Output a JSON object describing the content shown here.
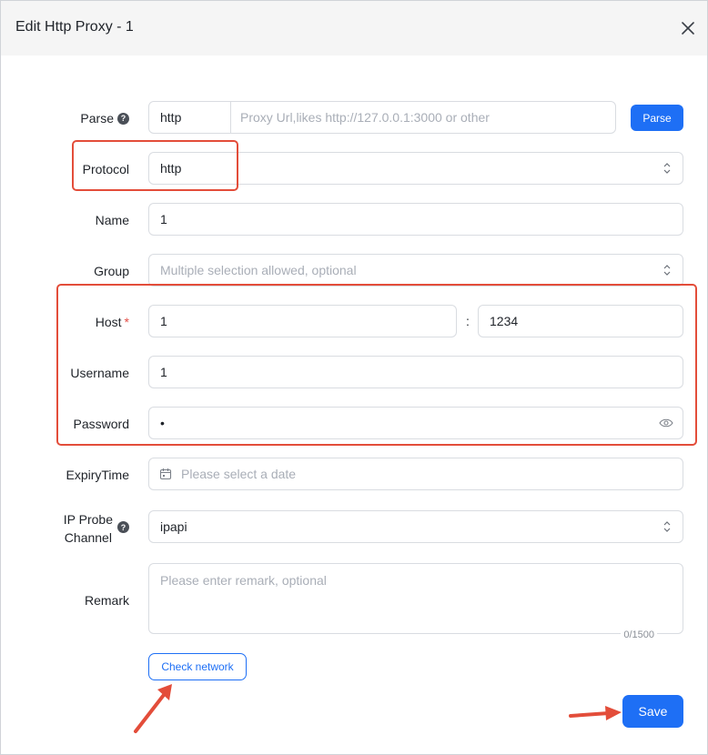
{
  "dialog": {
    "title": "Edit Http Proxy - 1",
    "close_icon": "close-icon"
  },
  "form": {
    "parse": {
      "label": "Parse",
      "scheme_value": "http",
      "url_placeholder": "Proxy Url,likes http://127.0.0.1:3000 or other",
      "button_label": "Parse"
    },
    "protocol": {
      "label": "Protocol",
      "value": "http"
    },
    "name": {
      "label": "Name",
      "value": "1"
    },
    "group": {
      "label": "Group",
      "placeholder": "Multiple selection allowed, optional"
    },
    "host": {
      "label": "Host",
      "required_mark": "*",
      "host_value": "1",
      "separator": ":",
      "port_value": "1234"
    },
    "username": {
      "label": "Username",
      "value": "1"
    },
    "password": {
      "label": "Password",
      "value": "•"
    },
    "expiry": {
      "label": "ExpiryTime",
      "placeholder": "Please select a date"
    },
    "ip_probe": {
      "label_line1": "IP Probe",
      "label_line2": "Channel",
      "value": "ipapi"
    },
    "remark": {
      "label": "Remark",
      "placeholder": "Please enter remark, optional",
      "counter": "0/1500"
    }
  },
  "actions": {
    "check_network_label": "Check network",
    "save_label": "Save"
  },
  "colors": {
    "primary": "#1e6ff5",
    "annotation_red": "#e34d3a",
    "required_red": "#e34d45"
  },
  "icons": [
    "close-icon",
    "help-icon",
    "chevron-updown-icon",
    "eye-icon",
    "calendar-icon"
  ]
}
